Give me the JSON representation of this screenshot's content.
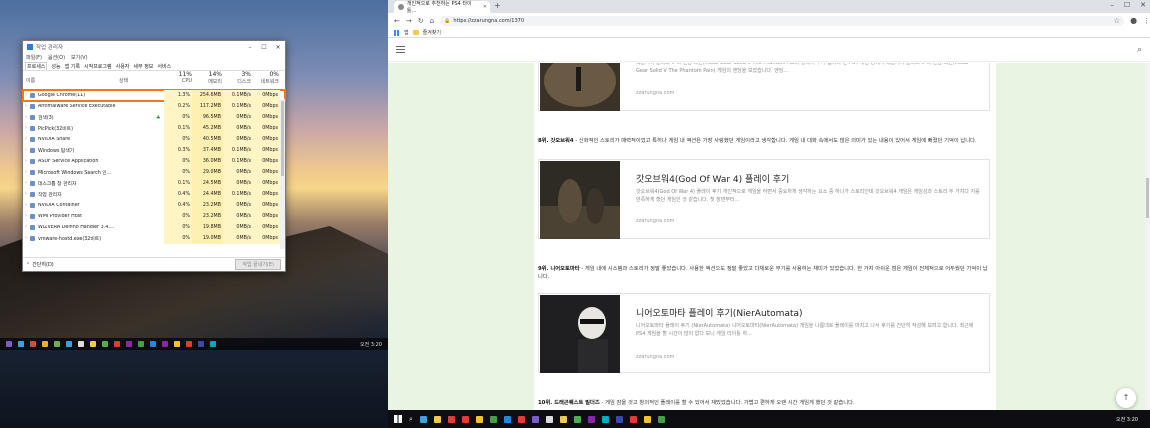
{
  "task_manager": {
    "title": "작업 관리자",
    "menu": [
      "파일(F)",
      "옵션(O)",
      "보기(V)"
    ],
    "tabs": [
      "프로세스",
      "성능",
      "앱 기록",
      "시작프로그램",
      "사용자",
      "세부 정보",
      "서비스"
    ],
    "columns": {
      "name": "이름",
      "status": "상태",
      "cpu_pct": "11%",
      "cpu_label": "CPU",
      "mem_pct": "14%",
      "mem_label": "메모리",
      "disk_pct": "3%",
      "disk_label": "디스크",
      "net_pct": "0%",
      "net_label": "네트워크"
    },
    "rows": [
      {
        "name": "Google Chrome(11)",
        "cpu": "1.3%",
        "mem": "254.6MB",
        "disk": "0.1MB/s",
        "net": "0Mbps",
        "highlight": true
      },
      {
        "name": "Antimalware Service Executable",
        "cpu": "0.2%",
        "mem": "117.2MB",
        "disk": "0.1MB/s",
        "net": "0Mbps"
      },
      {
        "name": "검색(3)",
        "cpu": "0%",
        "mem": "96.5MB",
        "disk": "0MB/s",
        "net": "0Mbps",
        "leaf": true
      },
      {
        "name": "PicPick(32비트)",
        "cpu": "0.1%",
        "mem": "45.2MB",
        "disk": "0MB/s",
        "net": "0Mbps"
      },
      {
        "name": "NVIDIA Share",
        "cpu": "0%",
        "mem": "40.5MB",
        "disk": "0MB/s",
        "net": "0Mbps"
      },
      {
        "name": "Windows 탐색기",
        "cpu": "0.3%",
        "mem": "37.4MB",
        "disk": "0.1MB/s",
        "net": "0Mbps"
      },
      {
        "name": "ASDF Service Application",
        "cpu": "0%",
        "mem": "36.0MB",
        "disk": "0.1MB/s",
        "net": "0Mbps"
      },
      {
        "name": "Microsoft Windows Search 인...",
        "cpu": "0%",
        "mem": "29.0MB",
        "disk": "0MB/s",
        "net": "0Mbps"
      },
      {
        "name": "데스크톱 창 관리자",
        "cpu": "0.1%",
        "mem": "24.5MB",
        "disk": "0MB/s",
        "net": "0Mbps"
      },
      {
        "name": "작업 관리자",
        "cpu": "0.4%",
        "mem": "24.4MB",
        "disk": "0.1MB/s",
        "net": "0Mbps"
      },
      {
        "name": "NVIDIA Container",
        "cpu": "0.4%",
        "mem": "23.2MB",
        "disk": "0MB/s",
        "net": "0Mbps"
      },
      {
        "name": "WMI Provider Host",
        "cpu": "0%",
        "mem": "23.2MB",
        "disk": "0MB/s",
        "net": "0Mbps"
      },
      {
        "name": "WIZVERA Delfino Handler 3.4....",
        "cpu": "0%",
        "mem": "19.8MB",
        "disk": "0MB/s",
        "net": "0Mbps"
      },
      {
        "name": "vmware-hostd.exe(32비트)",
        "cpu": "0%",
        "mem": "19.0MB",
        "disk": "0MB/s",
        "net": "0Mbps"
      }
    ],
    "footer_less": "간단히(D)",
    "end_task": "작업 끝내기(E)"
  },
  "left_taskbar": {
    "clock": "오전 3:20"
  },
  "browser": {
    "tab_title": "개인적으로 추천하는 PS4 타이틀...",
    "url": "https://zzarungna.com/1370",
    "bookmarks": [
      "앱",
      "즐겨찾기"
    ],
    "posts": [
      {
        "desc": "메탈기어 솔리드 V 더 팬텀 페인(Metal Gear Solid V The Phantom Pain) 플레이 후기 입니다 전 PS4 게임 중에서 메탈기어 솔리드 V 더 팬텀 페인(Metal Gear Solid V The Phantom Pain) 게임의 엔딩을 보았습니다. 엔딩...",
        "source": "zzarungna.com"
      },
      {
        "title": "갓오브워4(God Of War 4) 플레이 후기",
        "desc": "갓오브워4(God Of War 4) 플레이 후기 개인적으로 게임을 하면서 중요하게 생각하는 요소 중 하나가 스토리인데 갓오브워4 게임은 게임성과 스토리 두 가지다 지를 만족하게 했던 게임인 것 같습니다. 첫 장면부터...",
        "source": "zzarungna.com"
      },
      {
        "title": "니어오토마타 플레이 후기(NierAutomata)",
        "desc": "니어오토마타 플레이 후기 (NierAutomata) 니어오토마타(NierAutomata) 게임을 나름대로 플레이를 마치고 나서 후기를 간단히 작성해 보려고 합니다. 최근에 PS4 게임을 할 시간이 많이 없다 보니 게임 타이틀 하...",
        "source": "zzarungna.com"
      }
    ],
    "paragraphs": [
      {
        "rank": "8위. 갓오브워4",
        "text": " - 신화적인 스토리가 매력적이었고 특히나 게임 내 액션은 가장 사랑했던 게임이라고 생각합니다. 게임 내 대화 속에서도 많은 의미가 있는 내용이 있어서 게임에 빠졌던 기억이 납니다."
      },
      {
        "rank": "9위. 니어오토마타",
        "text": " - 게임 내에 시스템과 스토리가 정말 좋았습니다. 사용한 액션으도 정말 좋았고 다채로운 무기를 사용하는 재미가 있었습니다. 한 가지 아쉬운 점은 게임이 전체적으로 어두웠던 기억이 납니다."
      },
      {
        "rank": "10위. 드래곤퀘스트 빌더즈",
        "text": " - 게임 잠을 것고 창의적인 플레이를 할 수 있어서 재밌었습니다. 가볍고 편하게 오랜 시간 게임게 했던 것 같습니다."
      }
    ],
    "to_top": "↑"
  },
  "right_taskbar": {
    "clock": "오전 3:20"
  }
}
